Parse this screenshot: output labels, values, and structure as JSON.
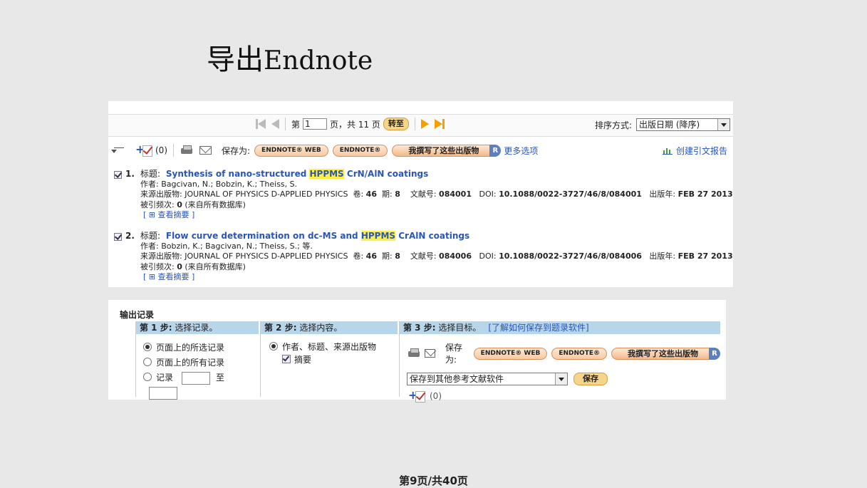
{
  "slide": {
    "title_cn": "导出",
    "title_en": "Endnote",
    "footer": "第9页/共40页"
  },
  "pager": {
    "prefix": "第",
    "page": "1",
    "suffix": "页，共 11 页",
    "go": "转至"
  },
  "sort": {
    "label": "排序方式:",
    "value": "出版日期 (降序)"
  },
  "toolbar": {
    "count": "(0)",
    "save_as": "保存为:",
    "endnote_web": "ENDNOTE® WEB",
    "endnote": "ENDNOTE®",
    "publications": "我撰写了这些出版物",
    "r": "R",
    "more": "更多选项",
    "citation_report": "创建引文报告"
  },
  "records": [
    {
      "num": "1.",
      "title_label": "标题:",
      "title_a": "Synthesis of nano-structured ",
      "title_hl": "HPPMS",
      "title_b": " CrN/AlN coatings",
      "authors": "作者: Bagcivan, N.; Bobzin, K.; Theiss, S.",
      "source_label": "来源出版物: JOURNAL OF PHYSICS D-APPLIED PHYSICS  卷: ",
      "vol": "46",
      "issue_label": "  期: ",
      "issue": "8",
      "art_label": "    文献号: ",
      "art": "084001",
      "doi_label": "   DOI: ",
      "doi": "10.1088/0022-3727/46/8/084001",
      "date_label": "   出版年: ",
      "date": "FEB 27 2013",
      "cited_label": "被引频次: ",
      "cited": "0",
      "cited_note": " (来自所有数据库)",
      "abstract": "[ ⊞ 查看摘要 ]"
    },
    {
      "num": "2.",
      "title_label": "标题:",
      "title_a": "Flow curve determination on dc-MS and ",
      "title_hl": "HPPMS",
      "title_b": " CrAlN coatings",
      "authors": "作者: Bobzin, K.; Bagcivan, N.; Theiss, S.; 等.",
      "source_label": "来源出版物: JOURNAL OF PHYSICS D-APPLIED PHYSICS  卷: ",
      "vol": "46",
      "issue_label": "  期: ",
      "issue": "8",
      "art_label": "    文献号: ",
      "art": "084006",
      "doi_label": "   DOI: ",
      "doi": "10.1088/0022-3727/46/8/084006",
      "date_label": "   出版年: ",
      "date": "FEB 27 2013",
      "cited_label": "被引频次: ",
      "cited": "0",
      "cited_note": " (来自所有数据库)",
      "abstract": "[ ⊞ 查看摘要 ]"
    }
  ],
  "export": {
    "title": "输出记录",
    "step1": {
      "head_b": "第 1 步:",
      "head": " 选择记录。",
      "opt1": "页面上的所选记录",
      "opt2": "页面上的所有记录",
      "opt3": "记录",
      "to": "至"
    },
    "step2": {
      "head_b": "第 2 步:",
      "head": " 选择内容。",
      "opt1": "作者、标题、来源出版物",
      "opt2": "摘要"
    },
    "step3": {
      "head_b": "第 3 步:",
      "head": " 选择目标。",
      "link": "[了解如何保存到题录软件]",
      "save_as": "保存为:",
      "endnote_web": "ENDNOTE® WEB",
      "endnote": "ENDNOTE®",
      "publications": "我撰写了这些出版物",
      "r": "R",
      "select": "保存到其他参考文献软件",
      "save": "保存",
      "count": "(0)"
    }
  }
}
